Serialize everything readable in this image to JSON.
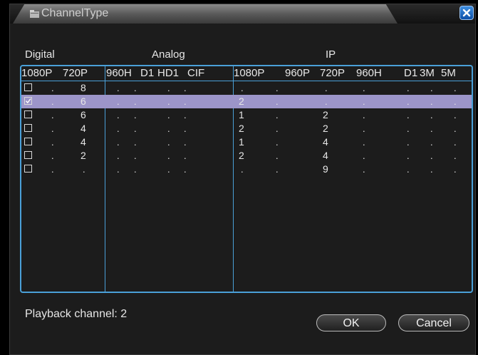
{
  "title": "ChannelType",
  "groups": {
    "digital": "Digital",
    "analog": "Analog",
    "ip": "IP"
  },
  "columns": [
    "1080P",
    "720P",
    "960H",
    "D1",
    "HD1",
    "CIF",
    "1080P",
    "960P",
    "720P",
    "960H",
    "D1",
    "3M",
    "5M"
  ],
  "rows": [
    {
      "checked": false,
      "selected": false,
      "values": [
        ".",
        "8",
        ".",
        ".",
        ".",
        ".",
        ".",
        ".",
        ".",
        ".",
        ".",
        ".",
        "."
      ]
    },
    {
      "checked": true,
      "selected": true,
      "values": [
        ".",
        "6",
        ".",
        ".",
        ".",
        ".",
        "2",
        ".",
        ".",
        ".",
        ".",
        ".",
        "."
      ]
    },
    {
      "checked": false,
      "selected": false,
      "values": [
        ".",
        "6",
        ".",
        ".",
        ".",
        ".",
        "1",
        ".",
        "2",
        ".",
        ".",
        ".",
        "."
      ]
    },
    {
      "checked": false,
      "selected": false,
      "values": [
        ".",
        "4",
        ".",
        ".",
        ".",
        ".",
        "2",
        ".",
        "2",
        ".",
        ".",
        ".",
        "."
      ]
    },
    {
      "checked": false,
      "selected": false,
      "values": [
        ".",
        "4",
        ".",
        ".",
        ".",
        ".",
        "1",
        ".",
        "4",
        ".",
        ".",
        ".",
        "."
      ]
    },
    {
      "checked": false,
      "selected": false,
      "values": [
        ".",
        "2",
        ".",
        ".",
        ".",
        ".",
        "2",
        ".",
        "4",
        ".",
        ".",
        ".",
        "."
      ]
    },
    {
      "checked": false,
      "selected": false,
      "values": [
        ".",
        ".",
        ".",
        ".",
        ".",
        ".",
        ".",
        ".",
        "9",
        ".",
        ".",
        ".",
        "."
      ]
    }
  ],
  "playback": "Playback channel: 2",
  "buttons": {
    "ok": "OK",
    "cancel": "Cancel"
  },
  "colors": {
    "accent": "#4aa0d8",
    "selected_row": "#9c95c9",
    "close_button": "#1f6fd0"
  }
}
